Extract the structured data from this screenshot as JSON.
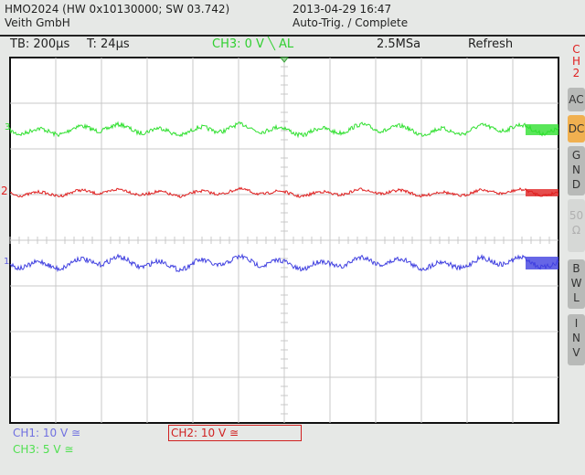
{
  "header": {
    "device": "HMO2024 (HW 0x10130000; SW 03.742)",
    "company": "Veith GmbH",
    "datetime": "2013-04-29 16:47",
    "status": "Auto-Trig. / Complete"
  },
  "statusbar": {
    "timebase": "TB: 200µs",
    "trigger_pos": "T: 24µs",
    "trigger": "CH3: 0 V ╲ AL",
    "samplerate": "2.5MSa",
    "mode": "Refresh"
  },
  "side_menu": {
    "channel": "C H 2",
    "items": [
      {
        "label": "AC",
        "state": "normal"
      },
      {
        "label": "DC",
        "state": "selected"
      },
      {
        "label": "G N D",
        "state": "normal"
      },
      {
        "label": "50 Ω",
        "state": "disabled"
      },
      {
        "label": "B W L",
        "state": "normal"
      },
      {
        "label": "I N V",
        "state": "normal"
      }
    ]
  },
  "channels": [
    {
      "name": "CH1",
      "marker": "1",
      "label": "CH1: 10 V ≅",
      "color": "#4040e0"
    },
    {
      "name": "CH2",
      "marker": "2",
      "label": "CH2: 10 V ≅",
      "color": "#e02020",
      "active": true
    },
    {
      "name": "CH3",
      "marker": "3",
      "label": "CH3: 5 V ≅",
      "color": "#30e030"
    }
  ]
}
